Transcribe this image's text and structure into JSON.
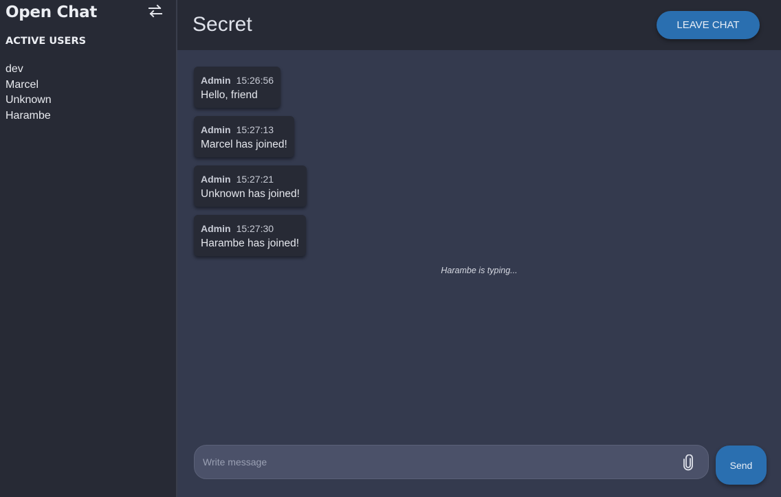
{
  "sidebar": {
    "app_title": "Open Chat",
    "switch_icon": "swap-arrows-icon",
    "section_title": "ACTIVE USERS",
    "users": [
      "dev",
      "Marcel",
      "Unknown",
      "Harambe"
    ]
  },
  "header": {
    "room_title": "Secret",
    "leave_label": "LEAVE CHAT"
  },
  "messages": [
    {
      "author": "Admin",
      "time": "15:26:56",
      "text": "Hello, friend"
    },
    {
      "author": "Admin",
      "time": "15:27:13",
      "text": "Marcel has joined!"
    },
    {
      "author": "Admin",
      "time": "15:27:21",
      "text": "Unknown has joined!"
    },
    {
      "author": "Admin",
      "time": "15:27:30",
      "text": "Harambe has joined!"
    }
  ],
  "typing_indicator": "Harambe is typing...",
  "composer": {
    "placeholder": "Write message",
    "value": "",
    "attach_icon": "paperclip-icon",
    "send_label": "Send"
  },
  "colors": {
    "background": "#343a4e",
    "sidebar": "#272a35",
    "accent": "#2a6fb0",
    "message_bubble": "#272a35",
    "input": "#4b5169"
  }
}
